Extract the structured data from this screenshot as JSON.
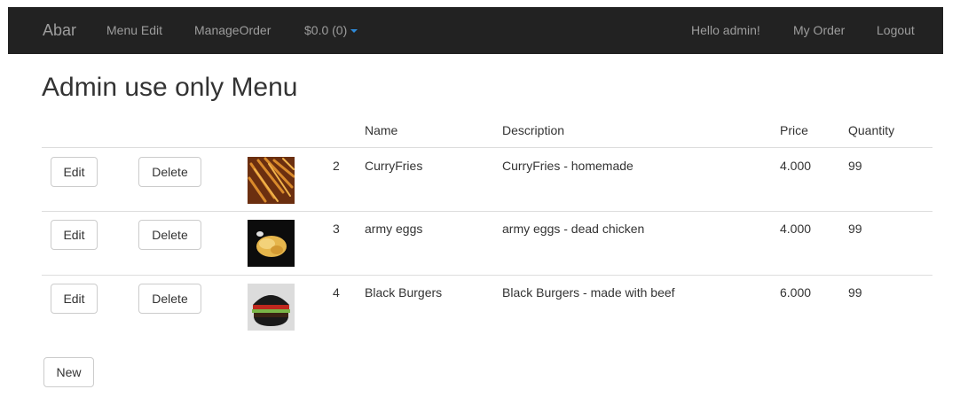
{
  "navbar": {
    "brand": "Abar",
    "menu_edit": "Menu Edit",
    "manage_order": "ManageOrder",
    "cart": "$0.0 (0)",
    "greeting": "Hello admin!",
    "my_order": "My Order",
    "logout": "Logout"
  },
  "page": {
    "title": "Admin use only Menu"
  },
  "table": {
    "headers": {
      "name": "Name",
      "description": "Description",
      "price": "Price",
      "quantity": "Quantity"
    },
    "edit_label": "Edit",
    "delete_label": "Delete",
    "rows": [
      {
        "id": "2",
        "name": "CurryFries",
        "description": "CurryFries - homemade",
        "price": "4.000",
        "quantity": "99",
        "image": "fries-image"
      },
      {
        "id": "3",
        "name": "army eggs",
        "description": "army eggs - dead chicken",
        "price": "4.000",
        "quantity": "99",
        "image": "eggs-image"
      },
      {
        "id": "4",
        "name": "Black Burgers",
        "description": "Black Burgers - made with beef",
        "price": "6.000",
        "quantity": "99",
        "image": "burger-image"
      }
    ]
  },
  "new_label": "New",
  "colors": {
    "navbar_bg": "#222222",
    "nav_text": "#9d9d9d",
    "caret": "#2e8ad8",
    "border": "#dddddd"
  }
}
